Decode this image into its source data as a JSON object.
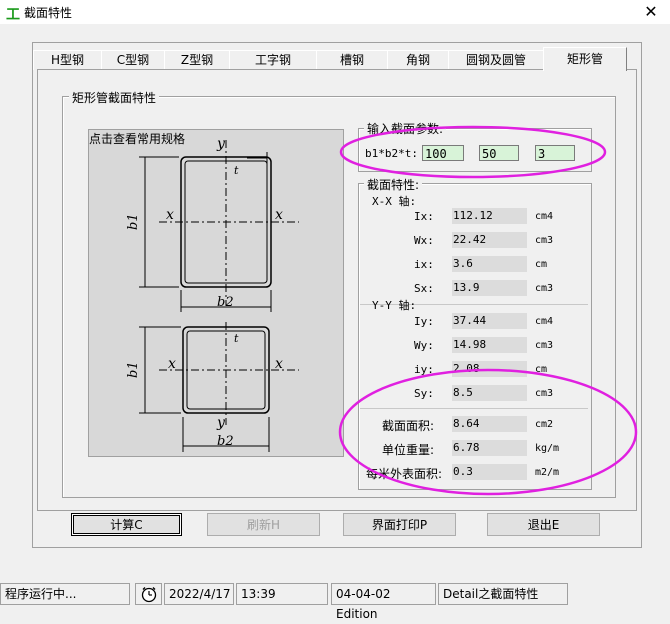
{
  "window": {
    "title": "截面特性",
    "app_icon": "工"
  },
  "tabs": [
    {
      "label": "H型钢"
    },
    {
      "label": "C型钢"
    },
    {
      "label": "Z型钢"
    },
    {
      "label": "工字钢"
    },
    {
      "label": "槽钢"
    },
    {
      "label": "角钢"
    },
    {
      "label": "圆钢及圆管"
    },
    {
      "label": "矩形管"
    }
  ],
  "active_tab": 7,
  "panel": {
    "group_title": "矩形管截面特性",
    "diagram_caption": "点击查看常用规格",
    "diagram_labels": {
      "y": "y",
      "x": "x",
      "t": "t",
      "b1": "b1",
      "b2": "b2"
    }
  },
  "input": {
    "group_title": "输入截面参数:",
    "label": "b1*b2*t:",
    "b1": "100",
    "b2": "50",
    "t": "3"
  },
  "props": {
    "group_title": "截面特性:",
    "xx_title": "X-X 轴:",
    "yy_title": "Y-Y 轴:",
    "xx": [
      {
        "label": "Ix:",
        "value": "112.12",
        "unit": "cm4"
      },
      {
        "label": "Wx:",
        "value": "22.42",
        "unit": "cm3"
      },
      {
        "label": "ix:",
        "value": "3.6",
        "unit": "cm"
      },
      {
        "label": "Sx:",
        "value": "13.9",
        "unit": "cm3"
      }
    ],
    "yy": [
      {
        "label": "Iy:",
        "value": "37.44",
        "unit": "cm4"
      },
      {
        "label": "Wy:",
        "value": "14.98",
        "unit": "cm3"
      },
      {
        "label": "iy:",
        "value": "2.08",
        "unit": "cm"
      },
      {
        "label": "Sy:",
        "value": "8.5",
        "unit": "cm3"
      }
    ],
    "extra": [
      {
        "label": "截面面积:",
        "value": "8.64",
        "unit": "cm2"
      },
      {
        "label": "单位重量:",
        "value": "6.78",
        "unit": "kg/m"
      },
      {
        "label": "每米外表面积:",
        "value": "0.3",
        "unit": "m2/m"
      }
    ]
  },
  "buttons": {
    "calc": "计算C",
    "refresh": "刷新H",
    "print": "界面打印P",
    "exit": "退出E"
  },
  "status": {
    "state": "程序运行中...",
    "clock_icon": "clock-icon",
    "date": "2022/4/17",
    "time": "13:39",
    "edition": "04-04-02 Edition",
    "detail": "Detail之截面特性"
  },
  "colors": {
    "highlight": "#e020e0",
    "input_bg": "#d8f3d8",
    "app_icon": "#1a9a1a"
  }
}
